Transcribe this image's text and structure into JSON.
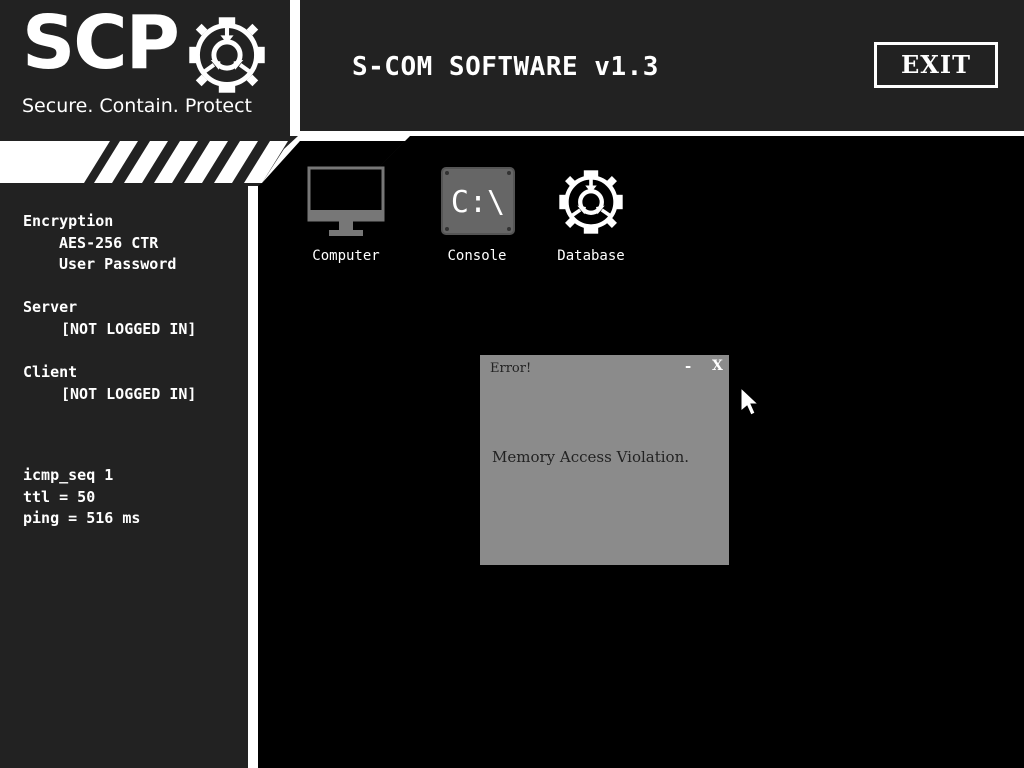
{
  "header": {
    "logo_text": "SCP",
    "logo_tagline": "Secure. Contain. Protect",
    "logo_emblem_icon": "scp-emblem-icon",
    "app_title": "S-COM SOFTWARE v1.3",
    "exit_label": "EXIT"
  },
  "sidebar": {
    "encryption_label": "Encryption",
    "encryption_cipher": "AES-256 CTR",
    "encryption_auth": "User Password",
    "server_label": "Server",
    "server_status": "[NOT LOGGED IN]",
    "client_label": "Client",
    "client_status": "[NOT LOGGED IN]",
    "icmp_seq": "icmp_seq 1",
    "ttl": "ttl = 50",
    "ping": "ping = 516 ms"
  },
  "desktop": {
    "icons": [
      {
        "label": "Computer",
        "icon": "computer-monitor-icon"
      },
      {
        "label": "Console",
        "icon": "console-icon",
        "glyph": "C:\\"
      },
      {
        "label": "Database",
        "icon": "scp-emblem-icon"
      }
    ]
  },
  "dialog": {
    "title": "Error!",
    "minimize_label": "-",
    "close_label": "X",
    "message": "Memory Access Violation."
  },
  "colors": {
    "panel": "#222222",
    "background": "#000000",
    "foreground": "#ffffff",
    "dialog_bg": "#8b8b8b",
    "dialog_text": "#222222"
  }
}
